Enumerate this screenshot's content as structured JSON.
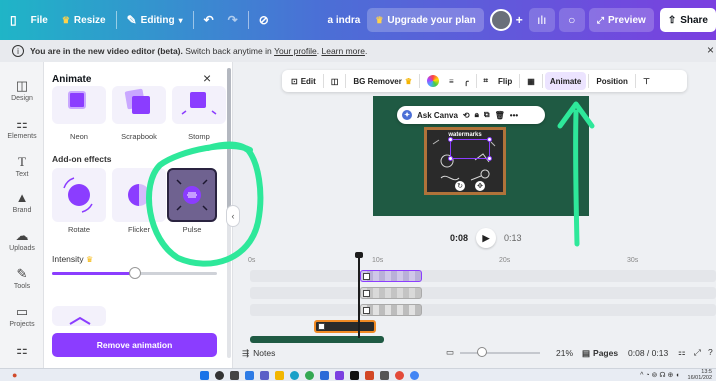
{
  "topbar": {
    "file": "File",
    "resize": "Resize",
    "editing": "Editing",
    "user_name": "a indra",
    "upgrade": "Upgrade your plan",
    "preview": "Preview",
    "share": "Share"
  },
  "notice": {
    "info": "i",
    "text_main": "You are in the new video editor (beta).",
    "text_rest": " Switch back anytime in ",
    "link_profile": "Your profile",
    "sep": ". ",
    "link_learn": "Learn more",
    "end": ".",
    "close": "×"
  },
  "rail": {
    "items": [
      {
        "icon": "◫",
        "label": "Design"
      },
      {
        "icon": "⚏",
        "label": "Elements"
      },
      {
        "icon": "T",
        "label": "Text"
      },
      {
        "icon": "▲",
        "label": "Brand"
      },
      {
        "icon": "☁",
        "label": "Uploads"
      },
      {
        "icon": "✎",
        "label": "Tools"
      },
      {
        "icon": "▭",
        "label": "Projects"
      },
      {
        "icon": "⚏",
        "label": "Apps"
      }
    ]
  },
  "panel": {
    "title": "Animate",
    "close": "×",
    "top_tiles": [
      "Neon",
      "Scrapbook",
      "Stomp"
    ],
    "addon_title": "Add-on effects",
    "addon_tiles": [
      "Rotate",
      "Flicker",
      "Pulse"
    ],
    "intensity_label": "Intensity",
    "intensity_value": 0.5,
    "remove_button": "Remove animation",
    "collapse": "‹"
  },
  "context_toolbar": {
    "edit": "Edit",
    "bg_remover": "BG Remover",
    "flip": "Flip",
    "animate": "Animate",
    "position": "Position"
  },
  "canvas": {
    "ask_canva": "Ask Canva",
    "board_title": "watermarks",
    "more": "•••"
  },
  "playback": {
    "current": "0:08",
    "duration": "0:13",
    "play": "▶"
  },
  "timeline": {
    "ticks": [
      "0s",
      "10s",
      "20s",
      "30s"
    ]
  },
  "footer": {
    "notes": "Notes",
    "zoom": "21%",
    "pages": "Pages",
    "time": "0:08 / 0:13"
  },
  "taskbar": {
    "time": "13:5",
    "date": "16/01/202"
  },
  "colors": {
    "accent": "#8b3dff",
    "canvas_bg": "#1f5a43",
    "annotation": "#2ee89a"
  }
}
